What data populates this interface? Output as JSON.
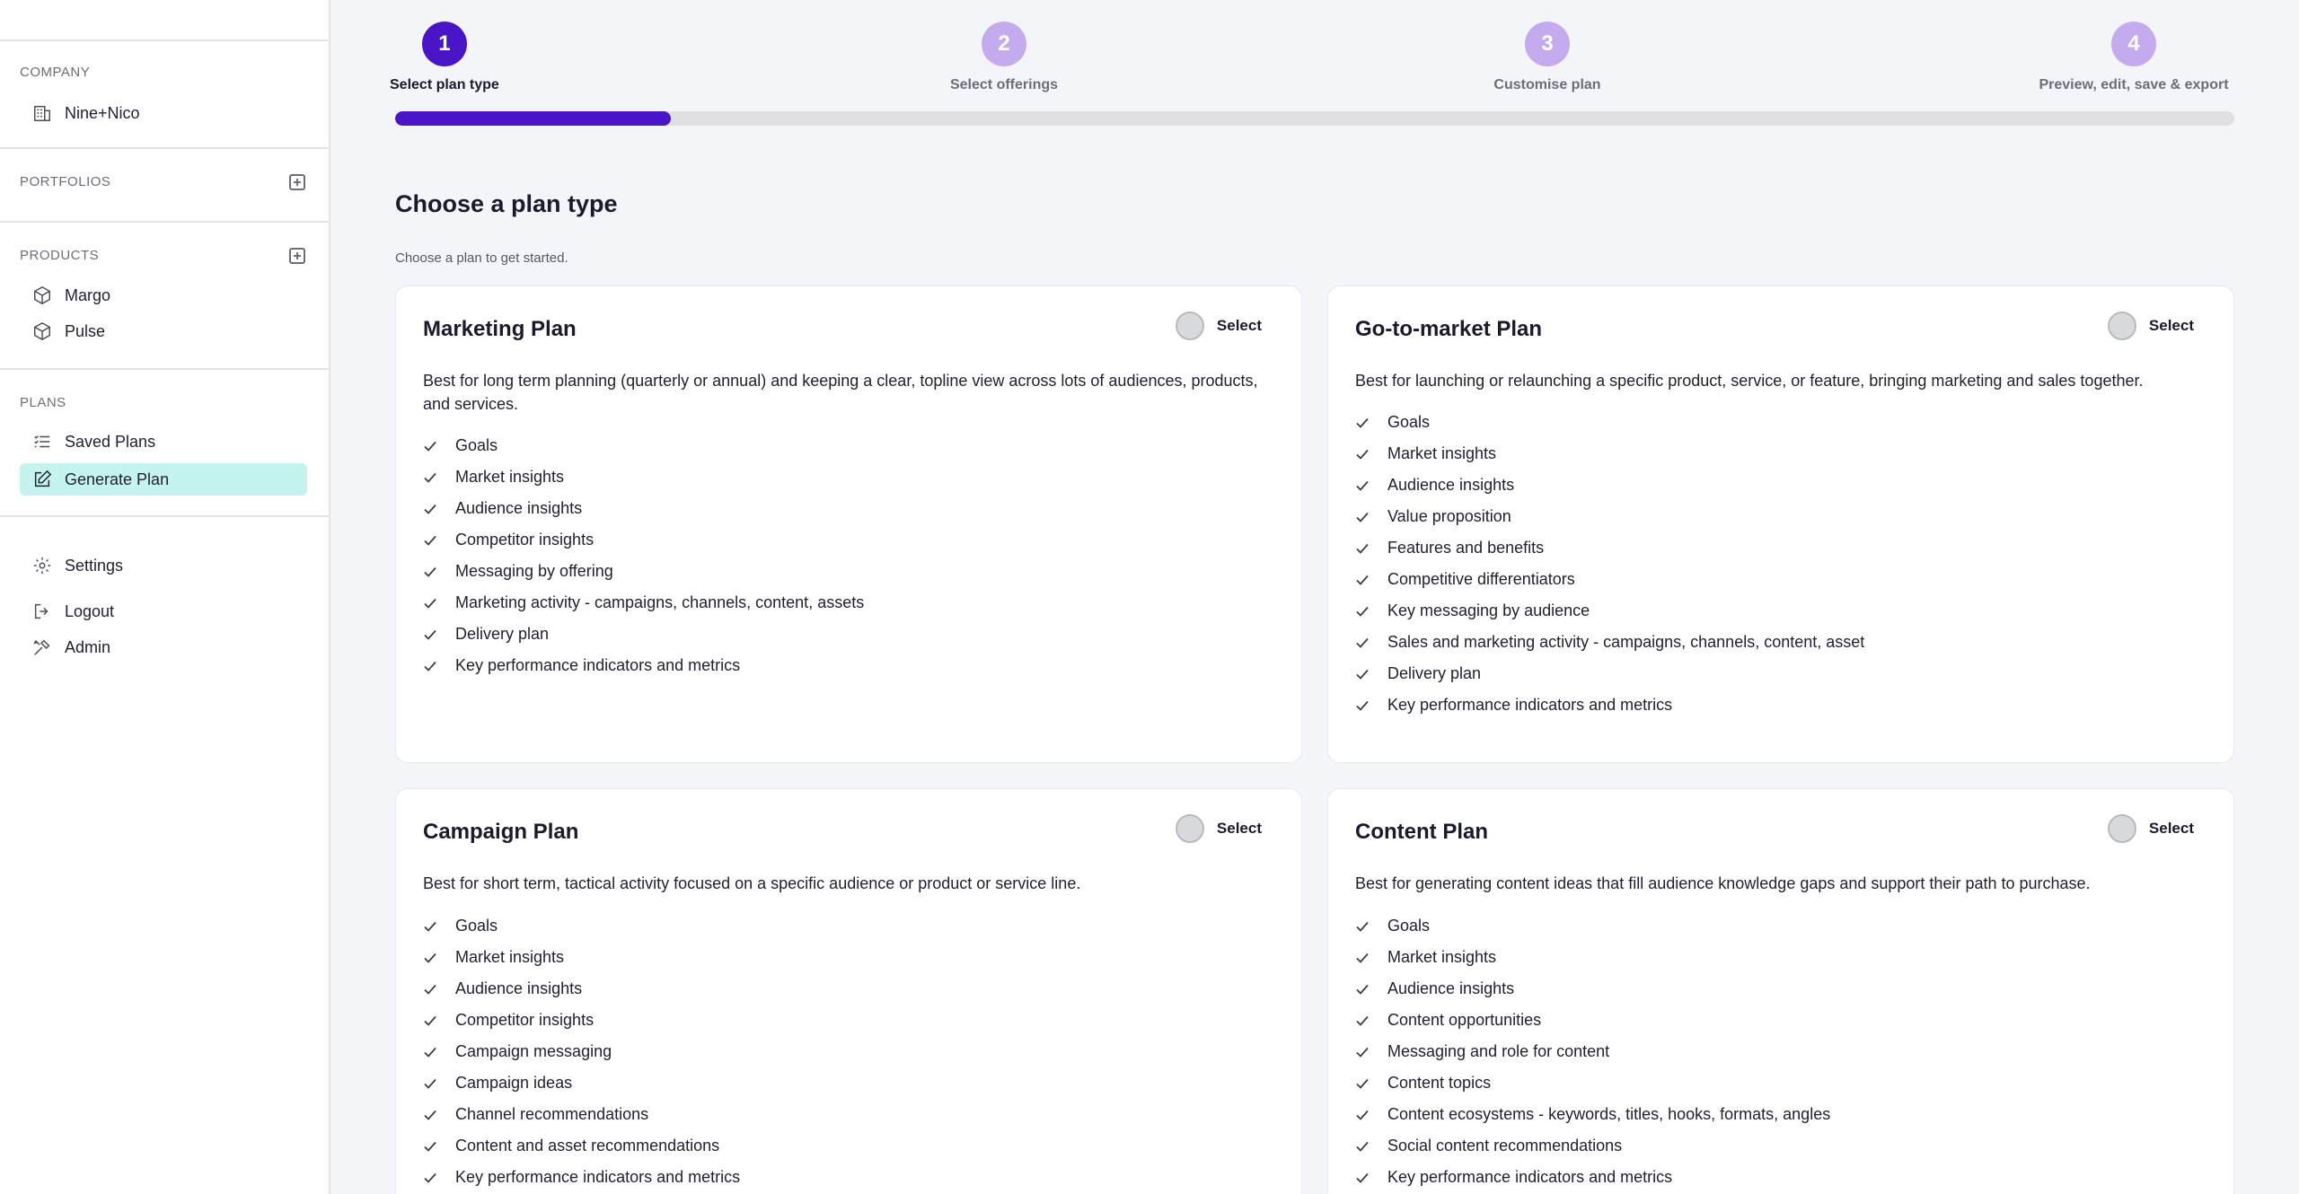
{
  "sidebar": {
    "company_heading": "COMPANY",
    "company_name": "Nine+Nico",
    "portfolios_heading": "PORTFOLIOS",
    "products_heading": "PRODUCTS",
    "products": [
      "Margo",
      "Pulse"
    ],
    "plans_heading": "PLANS",
    "saved_plans": "Saved Plans",
    "generate_plan": "Generate Plan",
    "settings": "Settings",
    "logout": "Logout",
    "admin": "Admin"
  },
  "stepper": {
    "steps": [
      {
        "number": "1",
        "label": "Select plan type",
        "state": "current"
      },
      {
        "number": "2",
        "label": "Select offerings",
        "state": "todo"
      },
      {
        "number": "3",
        "label": "Customise plan",
        "state": "todo"
      },
      {
        "number": "4",
        "label": "Preview, edit, save & export",
        "state": "todo"
      }
    ],
    "progress_fraction": 0.15
  },
  "page": {
    "title": "Choose a plan type",
    "subtitle": "Choose a plan to get started."
  },
  "cards": [
    {
      "title": "Marketing Plan",
      "select_label": "Select",
      "description": "Best for long term planning (quarterly or annual) and keeping a clear, topline view across lots of audiences, products, and services.",
      "features": [
        "Goals",
        "Market insights",
        "Audience insights",
        "Competitor insights",
        "Messaging by offering",
        "Marketing activity - campaigns, channels, content, assets",
        "Delivery plan",
        "Key performance indicators and metrics"
      ]
    },
    {
      "title": "Go-to-market Plan",
      "select_label": "Select",
      "description": "Best for launching or relaunching a specific product, service, or feature, bringing marketing and sales together.",
      "features": [
        "Goals",
        "Market insights",
        "Audience insights",
        "Value proposition",
        "Features and benefits",
        "Competitive differentiators",
        "Key messaging by audience",
        "Sales and marketing activity - campaigns, channels, content, asset",
        "Delivery plan",
        "Key performance indicators and metrics"
      ]
    },
    {
      "title": "Campaign Plan",
      "select_label": "Select",
      "description": "Best for short term, tactical activity focused on a specific audience or product or service line.",
      "features": [
        "Goals",
        "Market insights",
        "Audience insights",
        "Competitor insights",
        "Campaign messaging",
        "Campaign ideas",
        "Channel recommendations",
        "Content and asset recommendations",
        "Key performance indicators and metrics"
      ]
    },
    {
      "title": "Content Plan",
      "select_label": "Select",
      "description": "Best for generating content ideas that fill audience knowledge gaps and support their path to purchase.",
      "features": [
        "Goals",
        "Market insights",
        "Audience insights",
        "Content opportunities",
        "Messaging and role for content",
        "Content topics",
        "Content ecosystems - keywords, titles, hooks, formats, angles",
        "Social content recommendations",
        "Key performance indicators and metrics"
      ]
    }
  ],
  "colors": {
    "accent": "#4a14c7",
    "step_inactive": "#c4abee",
    "active_nav": "#c5f3ee"
  }
}
